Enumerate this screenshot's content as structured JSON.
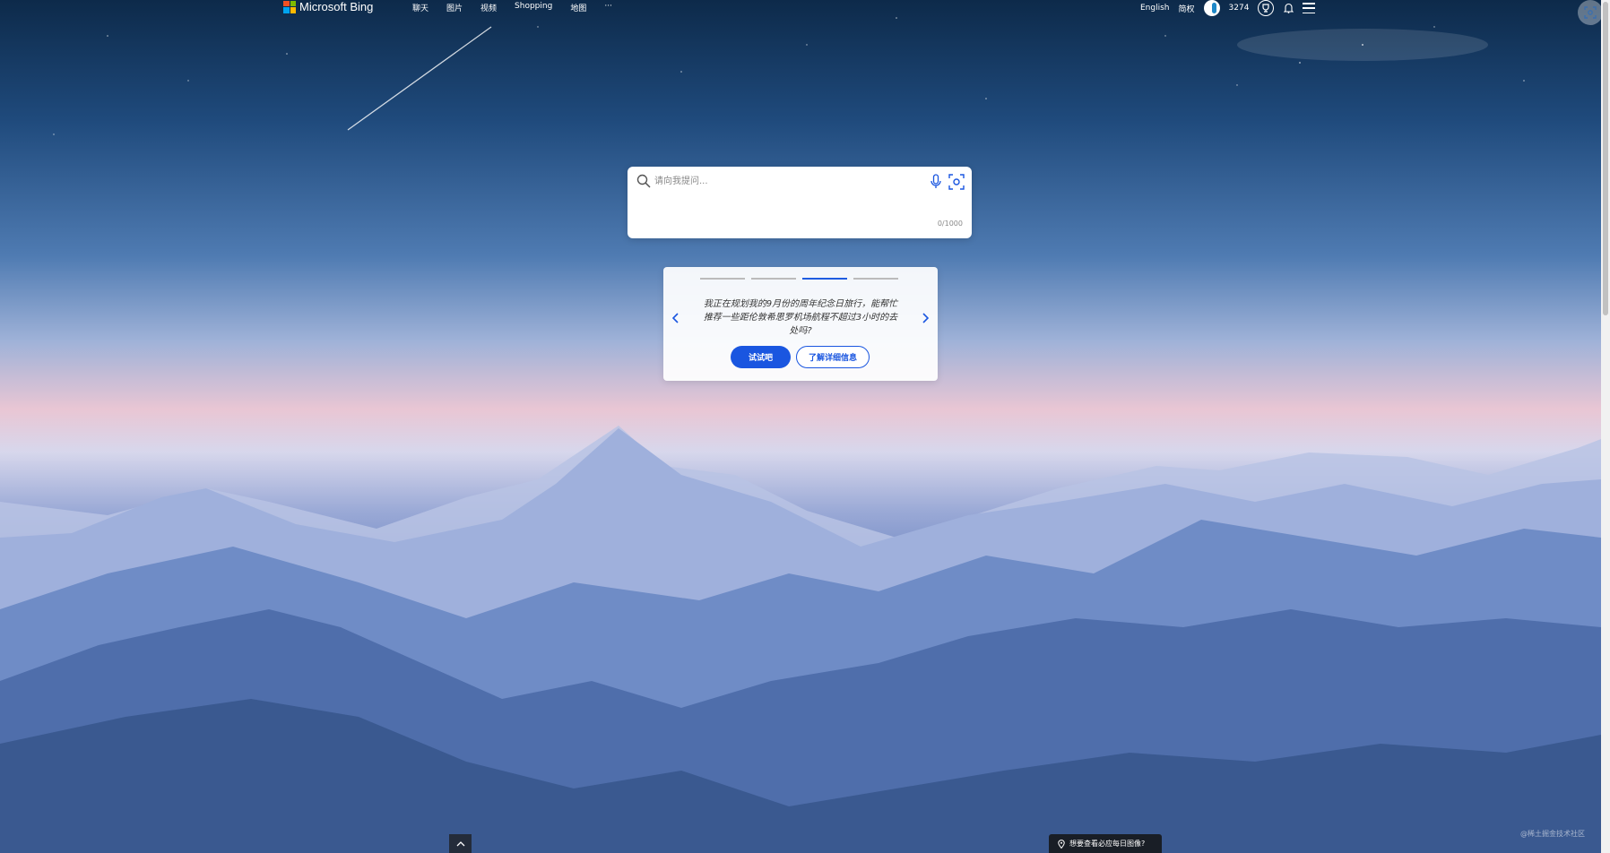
{
  "brand": {
    "name": "Microsoft Bing",
    "colors": [
      "#f25022",
      "#7fba00",
      "#00a4ef",
      "#ffb900"
    ]
  },
  "nav": {
    "items": [
      "聊天",
      "图片",
      "视频",
      "Shopping",
      "地图",
      "···"
    ]
  },
  "header": {
    "language": "English",
    "region": "简权",
    "points": "3274"
  },
  "search": {
    "placeholder": "请向我提问...",
    "counter": "0/1000"
  },
  "carousel": {
    "active_index": 2,
    "slide_count": 4,
    "prompt": "我正在规划我的9月份的周年纪念日旅行，能帮忙推荐一些距伦敦希思罗机场航程不超过3小时的去处吗?",
    "try_label": "试试吧",
    "learn_label": "了解详细信息"
  },
  "footer": {
    "image_prompt": "想要查看必应每日图像?",
    "watermark": "@稀土掘金技术社区"
  },
  "accent": "#1a56e0"
}
